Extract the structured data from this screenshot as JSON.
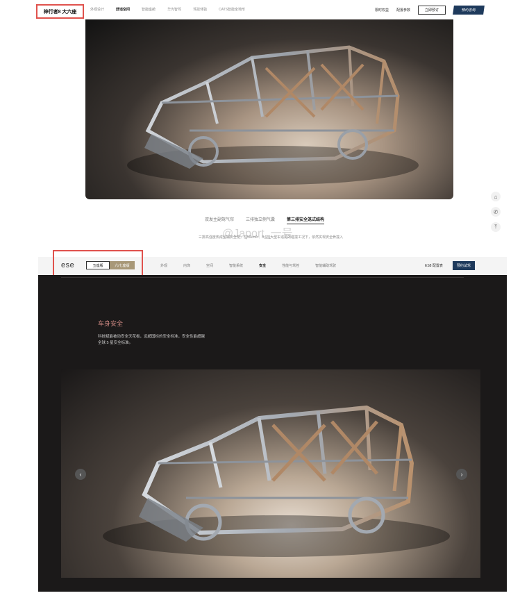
{
  "top_site": {
    "brand": "神行者8 大六座",
    "nav": [
      "外观设计",
      "舒适空间",
      "智能座舱",
      "华为智驾",
      "驾控体验",
      "CATS智能全地形"
    ],
    "active_nav": "舒适空间",
    "right_links": [
      "限时权益",
      "配置参数"
    ],
    "buttons": {
      "order": "立即预订",
      "test_drive": "预约咨询"
    },
    "feature_tabs": [
      "双发主副驾气帘",
      "三排独立侧气囊",
      "第三排安全笼式结构"
    ],
    "active_feature": "第三排安全笼式结构",
    "feature_description": "三排高强度热成型钢安全笼，在50km/h、8.6吨大型车追尾的碰撞工况下，依然实现安全骨撞入",
    "watermark": "@Japort_一号"
  },
  "bottom_site": {
    "logo": "ese",
    "segments": [
      "五座版",
      "六/七座版"
    ],
    "nav": [
      "外观",
      "内饰",
      "空间",
      "智能系统",
      "安全",
      "性能与驾控",
      "智能辅助驾驶"
    ],
    "active_nav": "安全",
    "right_link": "ES8 配置表",
    "button": "预约试驾",
    "section_title": "车身安全",
    "section_desc_line1": "科技赋能被动安全天花板，远超国标的安全标准，安全性能超越",
    "section_desc_line2": "全球 5 星安全标准。"
  },
  "icons": [
    "home-icon",
    "phone-icon",
    "top-icon",
    "chevron-left-icon",
    "chevron-right-icon"
  ],
  "colors": {
    "highlight": "#e0524d",
    "navy": "#1e3a5c",
    "dark_bg": "#1b1919",
    "section_title": "#c9857f",
    "segment_active": "#a89878"
  }
}
